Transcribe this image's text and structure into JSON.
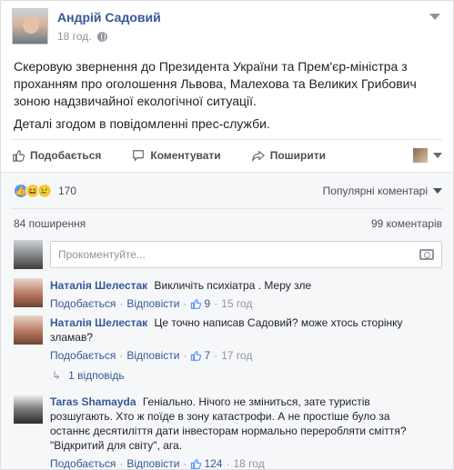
{
  "post": {
    "author": "Андрій Садовий",
    "time": "18 год.",
    "text": [
      "Скеровую звернення до Президента України та Прем'єр-міністра з проханням про оголошення Львова, Малехова та Великих Грибович зоною надзвичайної екологічної ситуації.",
      "Деталі згодом в повідомленні прес-служби."
    ]
  },
  "actions": {
    "like": "Подобається",
    "comment": "Коментувати",
    "share": "Поширити"
  },
  "reactions": {
    "count": "170",
    "sort": "Популярні коментарі"
  },
  "counts": {
    "shares": "84 поширення",
    "comments": "99 коментарів"
  },
  "compose": {
    "placeholder": "Прокоментуйте..."
  },
  "comments": [
    {
      "name": "Наталія Шелестак",
      "text": "Викличіть психіатра . Меру зле",
      "like": "Подобається",
      "reply": "Відповісти",
      "likes": "9",
      "time": "15 год"
    },
    {
      "name": "Наталія Шелестак",
      "text": "Це точно написав Садовий? може хтось сторінку зламав?",
      "like": "Подобається",
      "reply": "Відповісти",
      "likes": "7",
      "time": "17 год"
    },
    {
      "name": "Taras Shamayda",
      "text": "Геніально. Нічого не зміниться, зате туристів розшугають. Хто ж поїде в зону катастрофи. А не простіше було за останнє десятиліття дати інвесторам нормально переробляти сміття? \"Відкритий для світу\", ага.",
      "like": "Подобається",
      "reply": "Відповісти",
      "likes": "124",
      "time": "18 год"
    }
  ],
  "replies_label": "1 відповідь",
  "colors": {
    "link": "#365899",
    "muted": "#90949c",
    "like_blue": "#5890ff"
  }
}
